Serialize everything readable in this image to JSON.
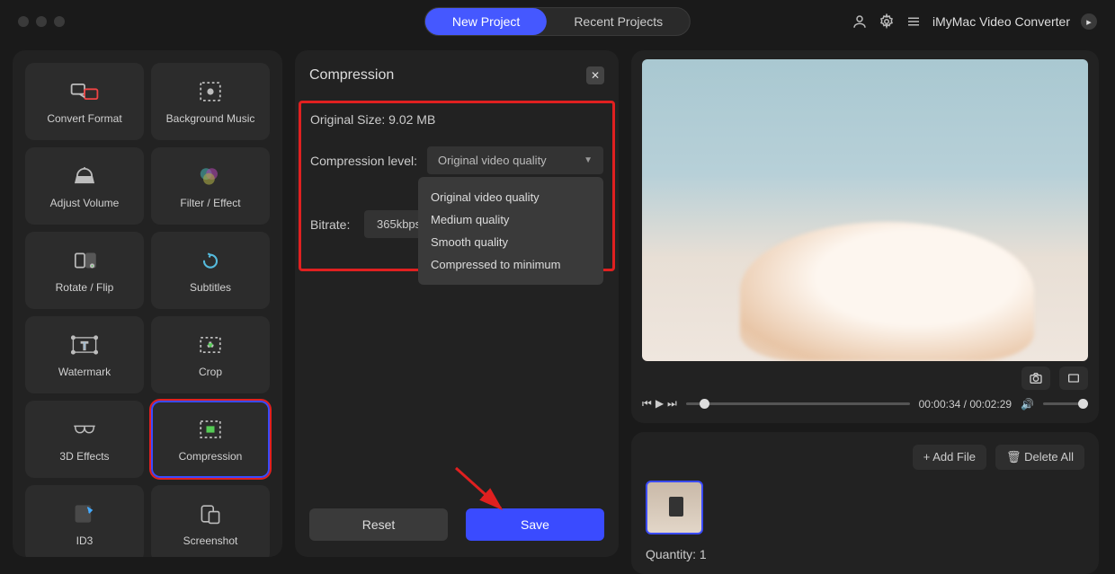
{
  "header": {
    "tabs": {
      "new": "New Project",
      "recent": "Recent Projects"
    },
    "app_title": "iMyMac Video Converter"
  },
  "sidebar": {
    "tools": [
      {
        "label": "Convert Format"
      },
      {
        "label": "Background Music"
      },
      {
        "label": "Adjust Volume"
      },
      {
        "label": "Filter / Effect"
      },
      {
        "label": "Rotate / Flip"
      },
      {
        "label": "Subtitles"
      },
      {
        "label": "Watermark"
      },
      {
        "label": "Crop"
      },
      {
        "label": "3D Effects"
      },
      {
        "label": "Compression"
      },
      {
        "label": "ID3"
      },
      {
        "label": "Screenshot"
      }
    ]
  },
  "panel": {
    "title": "Compression",
    "original_size": "Original Size: 9.02 MB",
    "compression_label": "Compression level:",
    "compression_value": "Original video quality",
    "bitrate_label": "Bitrate:",
    "bitrate_value": "365kbps",
    "options": [
      "Original video quality",
      "Medium quality",
      "Smooth quality",
      "Compressed to minimum"
    ],
    "reset": "Reset",
    "save": "Save"
  },
  "preview": {
    "time_pos": "00:00:34",
    "time_dur": "00:02:29"
  },
  "files": {
    "add": "+ Add File",
    "delete": "Delete All",
    "quantity_label": "Quantity:",
    "quantity_value": "1"
  }
}
